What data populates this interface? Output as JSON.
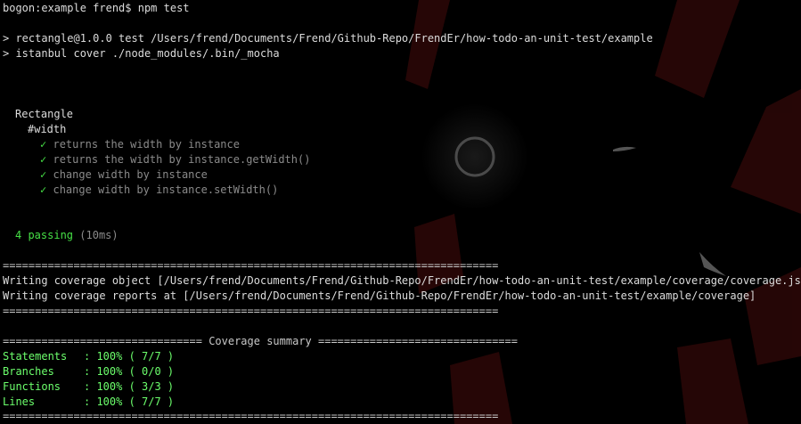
{
  "prompt": "bogon:example frend$ npm test",
  "npm_output": [
    "> rectangle@1.0.0 test /Users/frend/Documents/Frend/Github-Repo/FrendEr/how-todo-an-unit-test/example",
    "> istanbul cover ./node_modules/.bin/_mocha"
  ],
  "suite": {
    "name": "Rectangle",
    "subsuite": "#width",
    "check_symbol": "✓",
    "tests": [
      "returns the width by instance",
      "returns the width by instance.getWidth()",
      "change width by instance",
      "change width by instance.setWidth()"
    ]
  },
  "passing": {
    "label": "4 passing",
    "duration": "(10ms)"
  },
  "separator": "=============================================================================",
  "coverage_write": [
    "Writing coverage object [/Users/frend/Documents/Frend/Github-Repo/FrendEr/how-todo-an-unit-test/example/coverage/coverage.json]",
    "Writing coverage reports at [/Users/frend/Documents/Frend/Github-Repo/FrendEr/how-todo-an-unit-test/example/coverage]"
  ],
  "summary_header": "=============================== Coverage summary ===============================",
  "summary": [
    {
      "label": "Statements",
      "value": ": 100% ( 7/7 )"
    },
    {
      "label": "Branches",
      "value": ": 100% ( 0/0 )"
    },
    {
      "label": "Functions",
      "value": ": 100% ( 3/3 )"
    },
    {
      "label": "Lines",
      "value": ": 100% ( 7/7 )"
    }
  ],
  "colors": {
    "background": "#000000",
    "text": "#dcdcdc",
    "pass_green": "#46e046",
    "coverage_green": "#6cff6c",
    "wallpaper_red": "#3a0a0a"
  },
  "icons": {
    "pass": "checkmark-icon"
  }
}
